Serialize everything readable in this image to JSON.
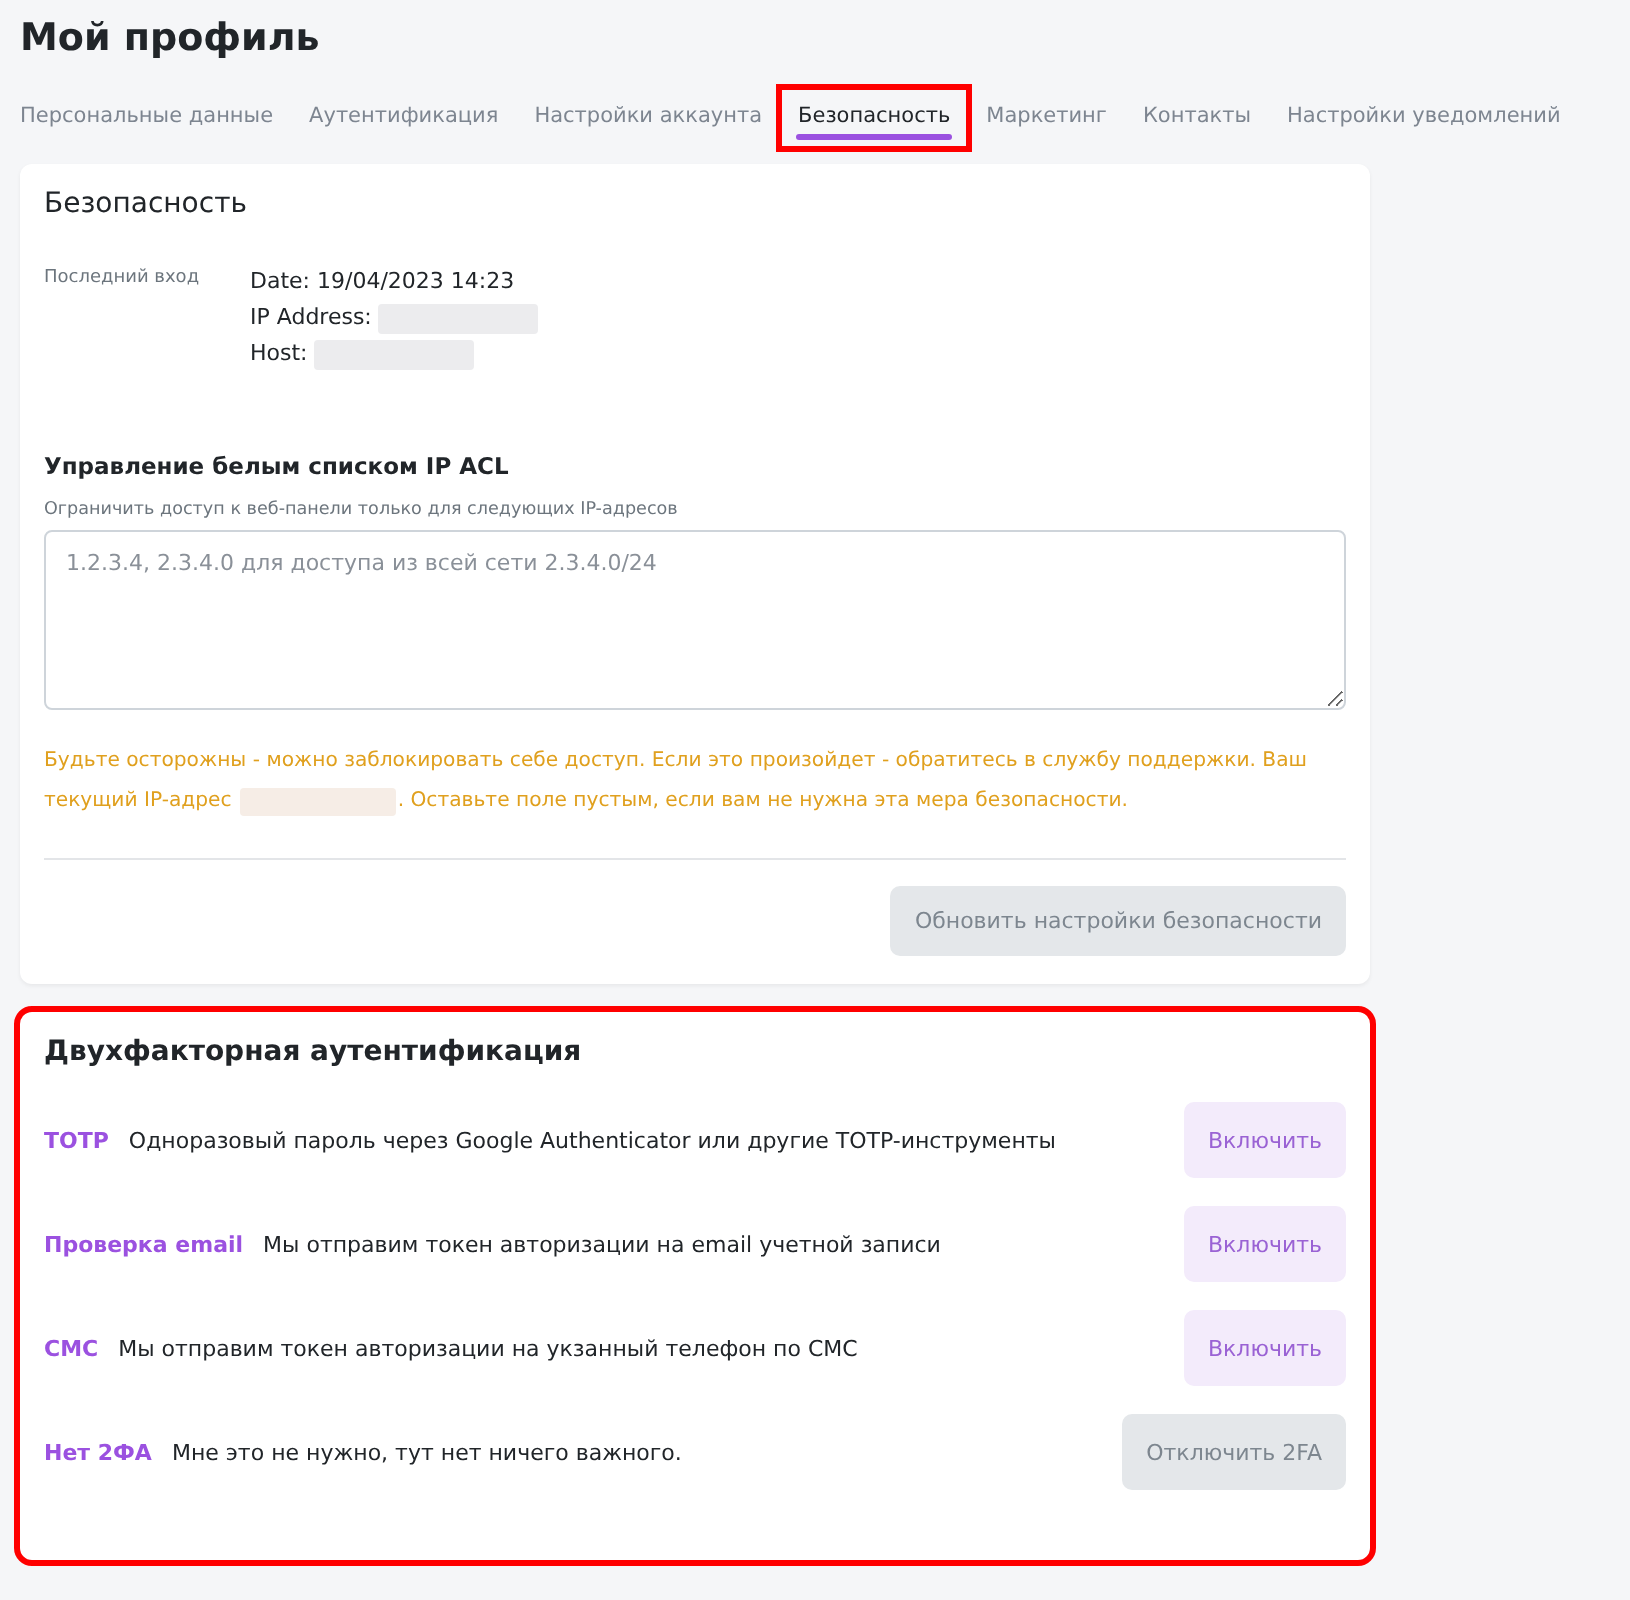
{
  "page": {
    "title": "Мой профиль"
  },
  "tabs": [
    {
      "label": "Персональные данные",
      "selected": false,
      "highlighted": false
    },
    {
      "label": "Аутентификация",
      "selected": false,
      "highlighted": false
    },
    {
      "label": "Настройки аккаунта",
      "selected": false,
      "highlighted": false
    },
    {
      "label": "Безопасность",
      "selected": true,
      "highlighted": true
    },
    {
      "label": "Маркетинг",
      "selected": false,
      "highlighted": false
    },
    {
      "label": "Контакты",
      "selected": false,
      "highlighted": false
    },
    {
      "label": "Настройки уведомлений",
      "selected": false,
      "highlighted": false
    }
  ],
  "security": {
    "title": "Безопасность",
    "last_login": {
      "label": "Последний вход",
      "lines": [
        {
          "label": "Date: 19/04/2023 14:23",
          "redacted": false
        },
        {
          "label": "IP Address:",
          "redacted": true
        },
        {
          "label": "Host:",
          "redacted": true
        }
      ]
    },
    "acl": {
      "title": "Управление белым списком IP ACL",
      "hint": "Ограничить доступ к веб-панели только для следующих IP-адресов",
      "placeholder": "1.2.3.4, 2.3.4.0 для доступа из всей сети 2.3.4.0/24",
      "warning_line": "Будьте осторожны - можно заблокировать себе доступ. Если это произойдет - обратитесь в службу поддержки. Ваш",
      "warning_before": "текущий IP-адрес",
      "warning_after": ". Оставьте поле пустым, если вам не нужна эта мера безопасности."
    },
    "button": {
      "label": "Обновить настройки безопасности",
      "disabled": true
    }
  },
  "two_factor": {
    "title": "Двухфакторная аутентификация",
    "highlighted": true,
    "methods": [
      {
        "name": "TOTP",
        "description": "Одноразовый пароль через Google Authenticator или другие TOTP-инструменты",
        "button": "Включить",
        "disabled": false
      },
      {
        "name": "Проверка email",
        "description": "Мы отправим токен авторизации на email учетной записи",
        "button": "Включить",
        "disabled": false
      },
      {
        "name": "СМС",
        "description": "Мы отправим токен авторизации на укзанный телефон по СМС",
        "button": "Включить",
        "disabled": false
      },
      {
        "name": "Нет 2ФА",
        "description": "Мне это не нужно, тут нет ничего важного.",
        "button": "Отключить 2FA",
        "disabled": true
      }
    ]
  }
}
